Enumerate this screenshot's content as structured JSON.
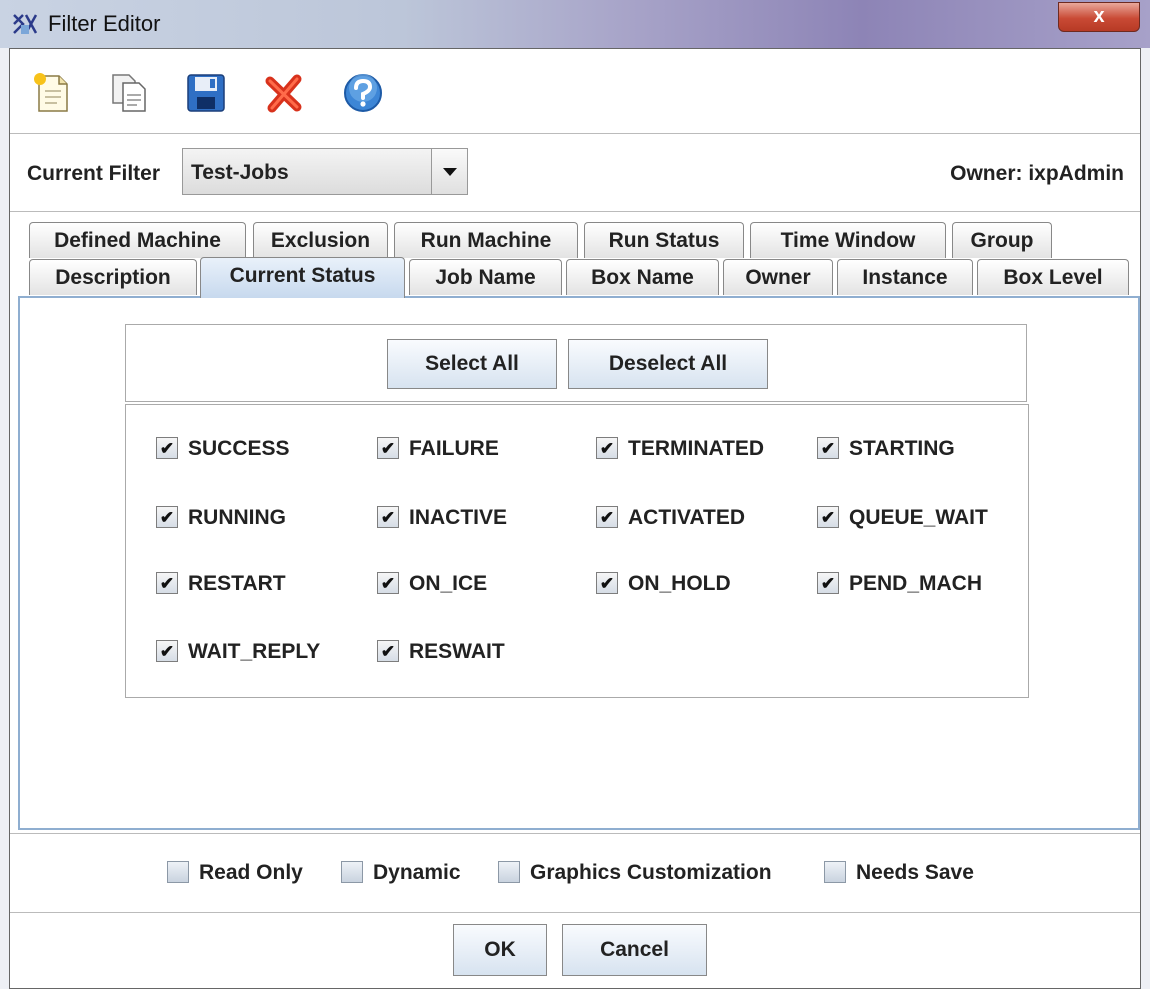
{
  "window": {
    "title": "Filter Editor",
    "close_glyph": "x"
  },
  "toolbar": {
    "icons": [
      "new-icon",
      "copy-icon",
      "save-icon",
      "delete-icon",
      "help-icon"
    ]
  },
  "filter": {
    "label": "Current Filter",
    "value": "Test-Jobs",
    "owner": "Owner: ixpAdmin"
  },
  "tabs": {
    "row1": [
      "Defined Machine",
      "Exclusion",
      "Run Machine",
      "Run Status",
      "Time Window",
      "Group"
    ],
    "row2": [
      "Description",
      "Current Status",
      "Job Name",
      "Box Name",
      "Owner",
      "Instance",
      "Box Level"
    ],
    "active": "Current Status"
  },
  "actions": {
    "select_all": "Select All",
    "deselect_all": "Deselect All"
  },
  "statuses": [
    {
      "label": "SUCCESS",
      "checked": true
    },
    {
      "label": "FAILURE",
      "checked": true
    },
    {
      "label": "TERMINATED",
      "checked": true
    },
    {
      "label": "STARTING",
      "checked": true
    },
    {
      "label": "RUNNING",
      "checked": true
    },
    {
      "label": "INACTIVE",
      "checked": true
    },
    {
      "label": "ACTIVATED",
      "checked": true
    },
    {
      "label": "QUEUE_WAIT",
      "checked": true
    },
    {
      "label": "RESTART",
      "checked": true
    },
    {
      "label": "ON_ICE",
      "checked": true
    },
    {
      "label": "ON_HOLD",
      "checked": true
    },
    {
      "label": "PEND_MACH",
      "checked": true
    },
    {
      "label": "WAIT_REPLY",
      "checked": true
    },
    {
      "label": "RESWAIT",
      "checked": true
    }
  ],
  "check_glyph": "✔",
  "options": [
    {
      "label": "Read Only",
      "checked": false
    },
    {
      "label": "Dynamic",
      "checked": false
    },
    {
      "label": "Graphics Customization",
      "checked": false
    },
    {
      "label": "Needs Save",
      "checked": false
    }
  ],
  "buttons": {
    "ok": "OK",
    "cancel": "Cancel"
  }
}
